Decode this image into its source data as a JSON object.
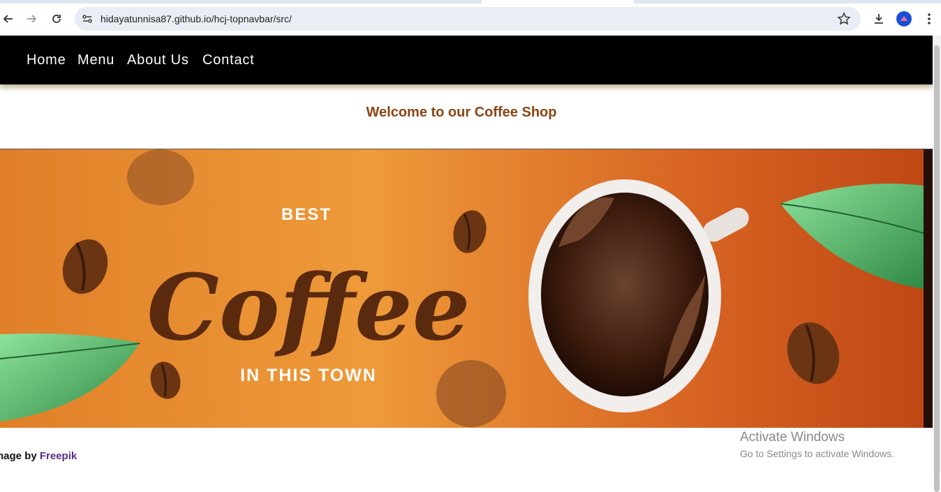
{
  "browser": {
    "url": "hidayatunnisa87.github.io/hcj-topnavbar/src/"
  },
  "nav": {
    "items": [
      "Home",
      "Menu",
      "About Us",
      "Contact"
    ]
  },
  "page": {
    "welcome": "Welcome to our Coffee Shop",
    "banner": {
      "line1": "BEST",
      "line2": "Coffee",
      "line3": "IN THIS TOWN"
    },
    "credit_prefix": "nage by",
    "credit_link": "Freepik"
  },
  "watermark": {
    "title": "Activate Windows",
    "subtitle": "Go to Settings to activate Windows."
  },
  "colors": {
    "nav_bg": "#000000",
    "welcome": "#8b4513",
    "banner_orange": "#e58a2a",
    "coffee_brown": "#5a2a0e",
    "freepik": "#5b2a86"
  }
}
